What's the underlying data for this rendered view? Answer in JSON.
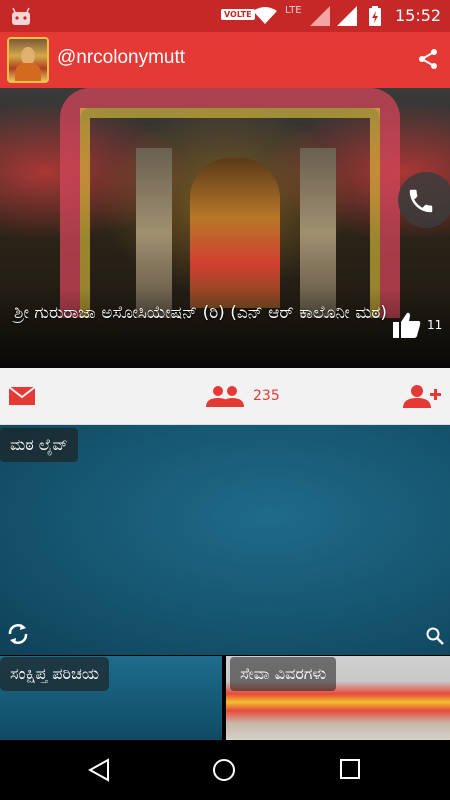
{
  "status_bar": {
    "network_badge": "VOLTE",
    "network_type": "LTE",
    "time": "15:52",
    "icons": [
      "android-icon",
      "wifi-icon",
      "signal-icon",
      "battery-icon"
    ]
  },
  "app_bar": {
    "title": "@nrcolonymutt",
    "icons": [
      "avatar",
      "share-icon"
    ]
  },
  "hero": {
    "title": "ಶ್ರೀ ಗುರುರಾಜಾ ಅಸೋಸಿಯೇಷನ್ (ರಿ) (ಎನ್ ಆರ್ ಕಾಲೊನೀ ಮಠ)",
    "like_count": "11",
    "icons": [
      "thumbs-up-icon",
      "phone-icon"
    ]
  },
  "action_bar": {
    "member_count": "235",
    "icons": [
      "mail-icon",
      "members-icon",
      "add-member-icon"
    ],
    "accent_color": "#e53935"
  },
  "tiles": {
    "live_label": "ಮಠ ಲೈವ್",
    "intro_label": "ಸಂಕ್ಷಿಪ್ತ ಪರಿಚಯ",
    "services_label": "ಸೇವಾ ವಿವರಗಳು",
    "icons": [
      "refresh-icon",
      "search-icon"
    ]
  },
  "nav_bar": {
    "icons": [
      "back-icon",
      "home-icon",
      "recents-icon"
    ]
  },
  "colors": {
    "status_bar": "#c62828",
    "app_bar": "#e53935",
    "action_bar": "#f2f2f2",
    "tile_blue": "#134f68"
  }
}
